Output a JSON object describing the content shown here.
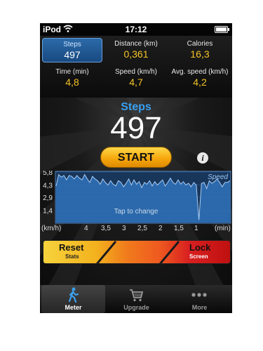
{
  "status_bar": {
    "carrier": "iPod",
    "time": "17:12"
  },
  "stats": [
    {
      "label": "Steps",
      "value": "497",
      "selected": true
    },
    {
      "label": "Distance (km)",
      "value": "0,361"
    },
    {
      "label": "Calories",
      "value": "16,3"
    },
    {
      "label": "Time (min)",
      "value": "4,8"
    },
    {
      "label": "Speed (km/h)",
      "value": "4,7"
    },
    {
      "label": "Avg. speed (km/h)",
      "value": "4,2"
    }
  ],
  "main": {
    "label": "Steps",
    "count": "497",
    "start_button": "START",
    "info_icon": "i"
  },
  "chart_data": {
    "type": "area",
    "title": "",
    "series": [
      {
        "name": "Speed",
        "values": [
          4.2,
          5.5,
          5.2,
          5.4,
          4.9,
          5.4,
          5.3,
          5.0,
          5.4,
          5.1,
          4.9,
          5.5,
          5.0,
          4.6,
          5.3,
          5.0,
          4.8,
          4.4,
          5.0,
          4.6,
          4.3,
          4.8,
          4.4,
          4.2,
          4.8,
          4.6,
          4.1,
          4.5,
          5.0,
          4.3,
          4.9,
          4.4,
          4.7,
          4.0,
          4.6,
          4.4,
          4.8,
          4.2,
          4.7,
          4.3,
          4.6,
          4.9,
          4.2,
          4.6,
          5.1,
          4.6,
          4.4,
          4.9,
          4.4,
          4.7,
          4.3,
          4.5,
          4.1,
          4.6,
          4.3,
          0.3,
          4.5,
          4.6,
          3.9,
          4.8,
          4.5,
          4.7,
          5.0,
          4.6,
          4.1,
          4.6,
          4.6,
          4.8
        ]
      }
    ],
    "y_ticks": [
      "5,8",
      "4,3",
      "2,9",
      "1,4"
    ],
    "ylim": [
      0,
      5.8
    ],
    "x_ticks": [
      "4",
      "3,5",
      "3",
      "2,5",
      "2",
      "1,5",
      "1"
    ],
    "ylabel": "(km/h)",
    "xlabel": "(min)",
    "overlay_text": "Tap to change",
    "colors": {
      "fill": "#2f6fb5",
      "line": "#a8cdf5",
      "bg": "#18355a"
    }
  },
  "slider": {
    "reset_label": "Reset",
    "reset_sub": "Stats",
    "lock_label": "Lock",
    "lock_sub": "Screen"
  },
  "tabs": [
    {
      "label": "Meter",
      "icon": "walking-person-icon",
      "active": true
    },
    {
      "label": "Upgrade",
      "icon": "shopping-cart-icon"
    },
    {
      "label": "More",
      "icon": "more-dots-icon"
    }
  ]
}
